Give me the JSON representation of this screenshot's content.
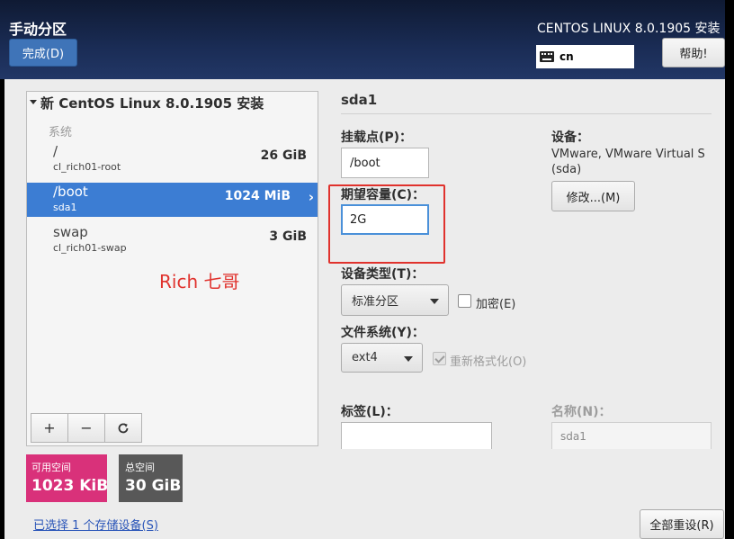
{
  "header": {
    "title": "手动分区",
    "done_label": "完成(D)",
    "product": "CENTOS LINUX 8.0.1905 安装",
    "keyboard_layout": "cn",
    "help_label": "帮助!"
  },
  "left": {
    "tree_title": "新 CentOS Linux 8.0.1905 安装",
    "group_label": "系统",
    "partitions": [
      {
        "mount": "/",
        "device": "cl_rich01-root",
        "size": "26 GiB",
        "selected": false
      },
      {
        "mount": "/boot",
        "device": "sda1",
        "size": "1024 MiB",
        "selected": true
      },
      {
        "mount": "swap",
        "device": "cl_rich01-swap",
        "size": "3 GiB",
        "selected": false
      }
    ],
    "watermark": "Rich 七哥",
    "toolbar": {
      "add": "+",
      "remove": "−"
    }
  },
  "summary": {
    "available_label": "可用空间",
    "available_value": "1023 KiB",
    "available_color": "#d9317a",
    "total_label": "总空间",
    "total_value": "30 GiB",
    "storage_link": "已选择 1 个存储设备(S)",
    "reset_label": "全部重设(R)"
  },
  "details": {
    "title": "sda1",
    "mount_label": "挂载点(P)：",
    "mount_value": "/boot",
    "capacity_label": "期望容量(C)：",
    "capacity_value": "2G",
    "device_label": "设备：",
    "device_text": "VMware, VMware Virtual S",
    "device_sub": "(sda)",
    "modify_label": "修改...(M)",
    "device_type_label": "设备类型(T)：",
    "device_type_value": "标准分区",
    "encrypt_label": "加密(E)",
    "fs_label": "文件系统(Y)：",
    "fs_value": "ext4",
    "reformat_label": "重新格式化(O)",
    "label_label": "标签(L)：",
    "label_value": "",
    "name_label": "名称(N)：",
    "name_value": "sda1"
  }
}
